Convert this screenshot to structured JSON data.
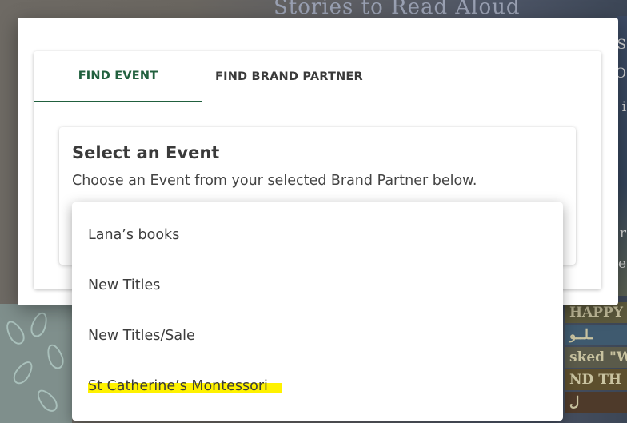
{
  "background": {
    "banner_text": "Stories to Read Aloud",
    "book_spines": [
      "HAPPY",
      "ـلــو",
      "sked \"W",
      "ND TH",
      "ل"
    ],
    "right_letters": [
      "S",
      "O",
      "i",
      "r",
      "e"
    ]
  },
  "modal": {
    "tabs": [
      {
        "label": "FIND EVENT",
        "active": true
      },
      {
        "label": "FIND BRAND PARTNER",
        "active": false
      }
    ],
    "section": {
      "title": "Select an Event",
      "description": "Choose an Event from your selected Brand Partner below."
    }
  },
  "dropdown": {
    "options": [
      {
        "label": "Lana’s books",
        "highlighted": false
      },
      {
        "label": "New Titles",
        "highlighted": false
      },
      {
        "label": "New Titles/Sale",
        "highlighted": false
      },
      {
        "label": "St Catherine’s Montessori",
        "highlighted": true
      }
    ]
  },
  "colors": {
    "accent": "#21603e",
    "highlight": "#fff200",
    "text": "#3a3a3a"
  }
}
